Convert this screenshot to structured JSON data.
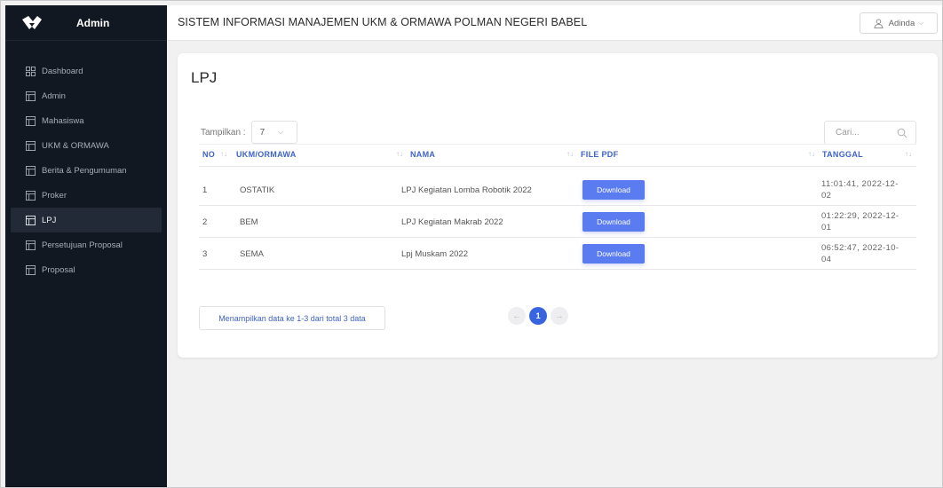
{
  "sidebar": {
    "brand": "Admin",
    "items": [
      {
        "label": "Dashboard",
        "icon": "grid-icon"
      },
      {
        "label": "Admin",
        "icon": "table-icon"
      },
      {
        "label": "Mahasiswa",
        "icon": "table-icon"
      },
      {
        "label": "UKM & ORMAWA",
        "icon": "table-icon"
      },
      {
        "label": "Berita & Pengumuman",
        "icon": "table-icon"
      },
      {
        "label": "Proker",
        "icon": "table-icon"
      },
      {
        "label": "LPJ",
        "icon": "table-icon",
        "active": true
      },
      {
        "label": "Persetujuan Proposal",
        "icon": "table-icon"
      },
      {
        "label": "Proposal",
        "icon": "table-icon"
      }
    ]
  },
  "header": {
    "title": "SISTEM INFORMASI MANAJEMEN UKM & ORMAWA POLMAN NEGERI BABEL",
    "user": "Adinda"
  },
  "main": {
    "title": "LPJ",
    "length_label": "Tampilkan :",
    "length_value": "7",
    "search_placeholder": "Cari...",
    "columns": [
      "NO",
      "UKM/ORMAWA",
      "NAMA",
      "FILE PDF",
      "TANGGAL"
    ],
    "rows": [
      {
        "no": "1",
        "ukm": "OSTATIK",
        "nama": "LPJ Kegiatan Lomba Robotik 2022",
        "file": "Download",
        "tanggal_1": "11:01:41, 2022-12-",
        "tanggal_2": "02"
      },
      {
        "no": "2",
        "ukm": "BEM",
        "nama": "LPJ Kegiatan Makrab 2022",
        "file": "Download",
        "tanggal_1": "01:22:29, 2022-12-",
        "tanggal_2": "01"
      },
      {
        "no": "3",
        "ukm": "SEMA",
        "nama": "Lpj Muskam 2022",
        "file": "Download",
        "tanggal_1": "06:52:47, 2022-10-",
        "tanggal_2": "04"
      }
    ],
    "info": "Menampilkan data ke 1-3 dari total 3 data",
    "pagination": {
      "prev": "←",
      "current": "1",
      "next": "→"
    }
  },
  "colors": {
    "sidebar_bg": "#121821",
    "accent": "#3f63c6",
    "button": "#5a7cf0",
    "page_active": "#3864e0"
  }
}
